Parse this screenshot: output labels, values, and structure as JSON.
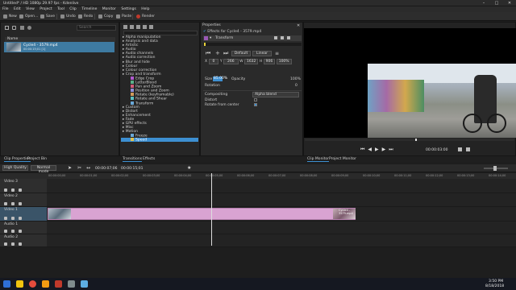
{
  "window": {
    "title": "Untitled* / HD 1080p 29.97 fps - Kdenlive",
    "min": "–",
    "max": "□",
    "close": "✕"
  },
  "menu": [
    "File",
    "Edit",
    "View",
    "Project",
    "Tool",
    "Clip",
    "Timeline",
    "Monitor",
    "Settings",
    "Help"
  ],
  "toolbar": {
    "new": "New",
    "open": "Open...",
    "save": "Save",
    "undo": "Undo",
    "redo": "Redo",
    "copy": "Copy",
    "paste": "Paste",
    "render": "Render"
  },
  "bin": {
    "search_placeholder": "Search",
    "col_name": "Name",
    "clip_name": "Cycle4 - 3579.mp4",
    "clip_duration": "00:00:15;01  [1]"
  },
  "effects": {
    "items": [
      {
        "label": "Alpha manipulation",
        "sub": false
      },
      {
        "label": "Analysis and data",
        "sub": false
      },
      {
        "label": "Artistic",
        "sub": false
      },
      {
        "label": "Audio",
        "sub": false
      },
      {
        "label": "Audio channels",
        "sub": false
      },
      {
        "label": "Audio correction",
        "sub": false
      },
      {
        "label": "Blur and hide",
        "sub": false
      },
      {
        "label": "Colour",
        "sub": false
      },
      {
        "label": "Colour correction",
        "sub": false
      },
      {
        "label": "Crop and transform",
        "sub": false
      },
      {
        "label": "Edge Crop",
        "sub": true
      },
      {
        "label": "LetterBlood",
        "sub": true
      },
      {
        "label": "Pan and Zoom",
        "sub": true
      },
      {
        "label": "Position and Zoom",
        "sub": true
      },
      {
        "label": "Rotate (keyframable)",
        "sub": true
      },
      {
        "label": "Rotate and Shear",
        "sub": true
      },
      {
        "label": "Transform",
        "sub": true
      },
      {
        "label": "Custom",
        "sub": false
      },
      {
        "label": "Distort",
        "sub": false
      },
      {
        "label": "Enhancement",
        "sub": false
      },
      {
        "label": "Fade",
        "sub": false
      },
      {
        "label": "GPU effects",
        "sub": false
      },
      {
        "label": "Misc",
        "sub": false
      },
      {
        "label": "Motion",
        "sub": false
      },
      {
        "label": "Freeze",
        "sub": true
      },
      {
        "label": "Speed",
        "sub": true
      }
    ]
  },
  "properties": {
    "title": "Properties",
    "effects_for": "Effects for Cycle4 - 3579.mp4",
    "effect_name": "Transform",
    "timecode": "00:00:00;00",
    "mode": "Default",
    "linear": "Linear",
    "x_label": "X",
    "x_val": "0",
    "y_label": "Y",
    "y_val": "266",
    "w_label": "W",
    "w_val": "1632",
    "h_label": "H",
    "h_val": "906",
    "size_pct": "100%",
    "size_label": "Size",
    "size_val": "85.00%",
    "opacity_label": "Opacity",
    "opacity_val": "100%",
    "rotation_label": "Rotation",
    "rotation_val": "0",
    "compositing_label": "Compositing",
    "compositing_val": "Alpha blend",
    "distort_label": "Distort",
    "rotate_center_label": "Rotate from center"
  },
  "tabs_mid": {
    "clip_props": "Clip Properties",
    "project_bin": "Project Bin",
    "transitions": "Transitions",
    "effects": "Effects",
    "clip_monitor": "Clip Monitor",
    "project_monitor": "Project Monitor"
  },
  "monitor": {
    "timecode": "00:00:03:00"
  },
  "timeline_toolbar": {
    "quality": "High Quality",
    "mode": "Normal mode",
    "position": "00:00:07;06",
    "duration": "00:00:15;01"
  },
  "ruler_ticks": [
    "00:00:00;00",
    "00:00:01;00",
    "00:00:02;00",
    "00:00:03;00",
    "00:00:04;00",
    "00:00:05;00",
    "00:00:06;00",
    "00:00:07;00",
    "00:00:08;00",
    "00:00:09;00",
    "00:00:10;00",
    "00:00:11;00",
    "00:00:12;00",
    "00:00:13;00",
    "00:00:14;00"
  ],
  "tracks": [
    {
      "name": "Video 3"
    },
    {
      "name": "Video 2"
    },
    {
      "name": "Video 1"
    },
    {
      "name": "Audio 1"
    },
    {
      "name": "Audio 2"
    }
  ],
  "timeline_clip": {
    "label": "Cycle4 - 3579.mp4",
    "color": "#d9a3d2"
  },
  "taskbar": {
    "time": "3:50 PM",
    "date": "8/18/2018"
  },
  "colors": {
    "accent": "#3d8fd1",
    "selection": "#3e7aa1",
    "clip": "#d9a3d2"
  }
}
